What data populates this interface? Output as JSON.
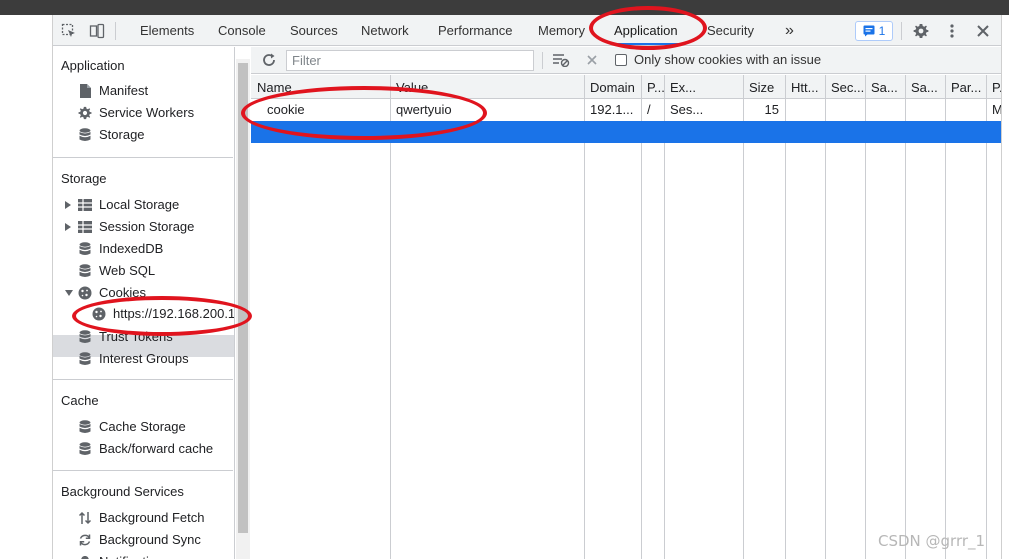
{
  "tabs": [
    {
      "label": "Elements"
    },
    {
      "label": "Console"
    },
    {
      "label": "Sources"
    },
    {
      "label": "Network"
    },
    {
      "label": "Performance"
    },
    {
      "label": "Memory"
    },
    {
      "label": "Application",
      "active": true
    },
    {
      "label": "Security"
    }
  ],
  "more_tabs": "»",
  "issues_count": "1",
  "sidebar": {
    "application": {
      "title": "Application",
      "items": [
        {
          "label": "Manifest",
          "icon": "document-icon"
        },
        {
          "label": "Service Workers",
          "icon": "gear-icon"
        },
        {
          "label": "Storage",
          "icon": "database-icon"
        }
      ]
    },
    "storage": {
      "title": "Storage",
      "items": [
        {
          "label": "Local Storage",
          "icon": "grid-icon"
        },
        {
          "label": "Session Storage",
          "icon": "grid-icon"
        },
        {
          "label": "IndexedDB",
          "icon": "database-icon"
        },
        {
          "label": "Web SQL",
          "icon": "database-icon"
        },
        {
          "label": "Cookies",
          "icon": "cookie-icon"
        },
        {
          "label": "https://192.168.200.1",
          "icon": "cookie-icon",
          "selected": true
        },
        {
          "label": "Trust Tokens",
          "icon": "database-icon"
        },
        {
          "label": "Interest Groups",
          "icon": "database-icon"
        }
      ]
    },
    "cache": {
      "title": "Cache",
      "items": [
        {
          "label": "Cache Storage",
          "icon": "database-icon"
        },
        {
          "label": "Back/forward cache",
          "icon": "database-icon"
        }
      ]
    },
    "background": {
      "title": "Background Services",
      "items": [
        {
          "label": "Background Fetch",
          "icon": "arrows-updown-icon"
        },
        {
          "label": "Background Sync",
          "icon": "sync-icon"
        },
        {
          "label": "Notifications",
          "icon": "bell-icon"
        }
      ]
    }
  },
  "toolbar": {
    "filter_placeholder": "Filter",
    "only_issues_label": "Only show cookies with an issue"
  },
  "table": {
    "columns": [
      "Name",
      "Value",
      "Domain",
      "P...",
      "Ex...",
      "Size",
      "Htt...",
      "Sec...",
      "Sa...",
      "Sa...",
      "Par...",
      "P..."
    ],
    "rows": [
      [
        "cookie",
        "qwertyuio",
        "192.1...",
        "/",
        "Ses...",
        "15",
        "",
        "",
        "",
        "",
        "",
        "Me..."
      ]
    ]
  },
  "watermark": "CSDN @grrr_1",
  "colors": {
    "accent": "#1a73e8",
    "annotation": "#e0141e",
    "selected_row": "#1a73e8"
  }
}
